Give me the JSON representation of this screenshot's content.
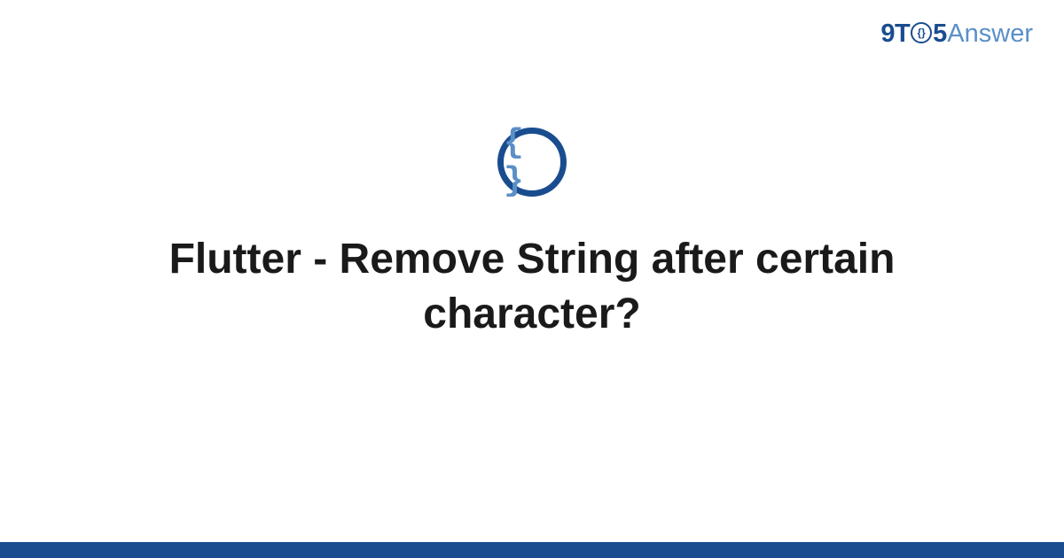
{
  "header": {
    "logo_9t": "9T",
    "logo_circle_inner": "{}",
    "logo_5": "5",
    "logo_answer": "Answer"
  },
  "icon": {
    "braces": "{ }",
    "name": "code-braces-icon"
  },
  "title": "Flutter - Remove String after certain character?",
  "colors": {
    "primary": "#1a4d8f",
    "secondary": "#5a8fc7",
    "text": "#1a1a1a"
  }
}
